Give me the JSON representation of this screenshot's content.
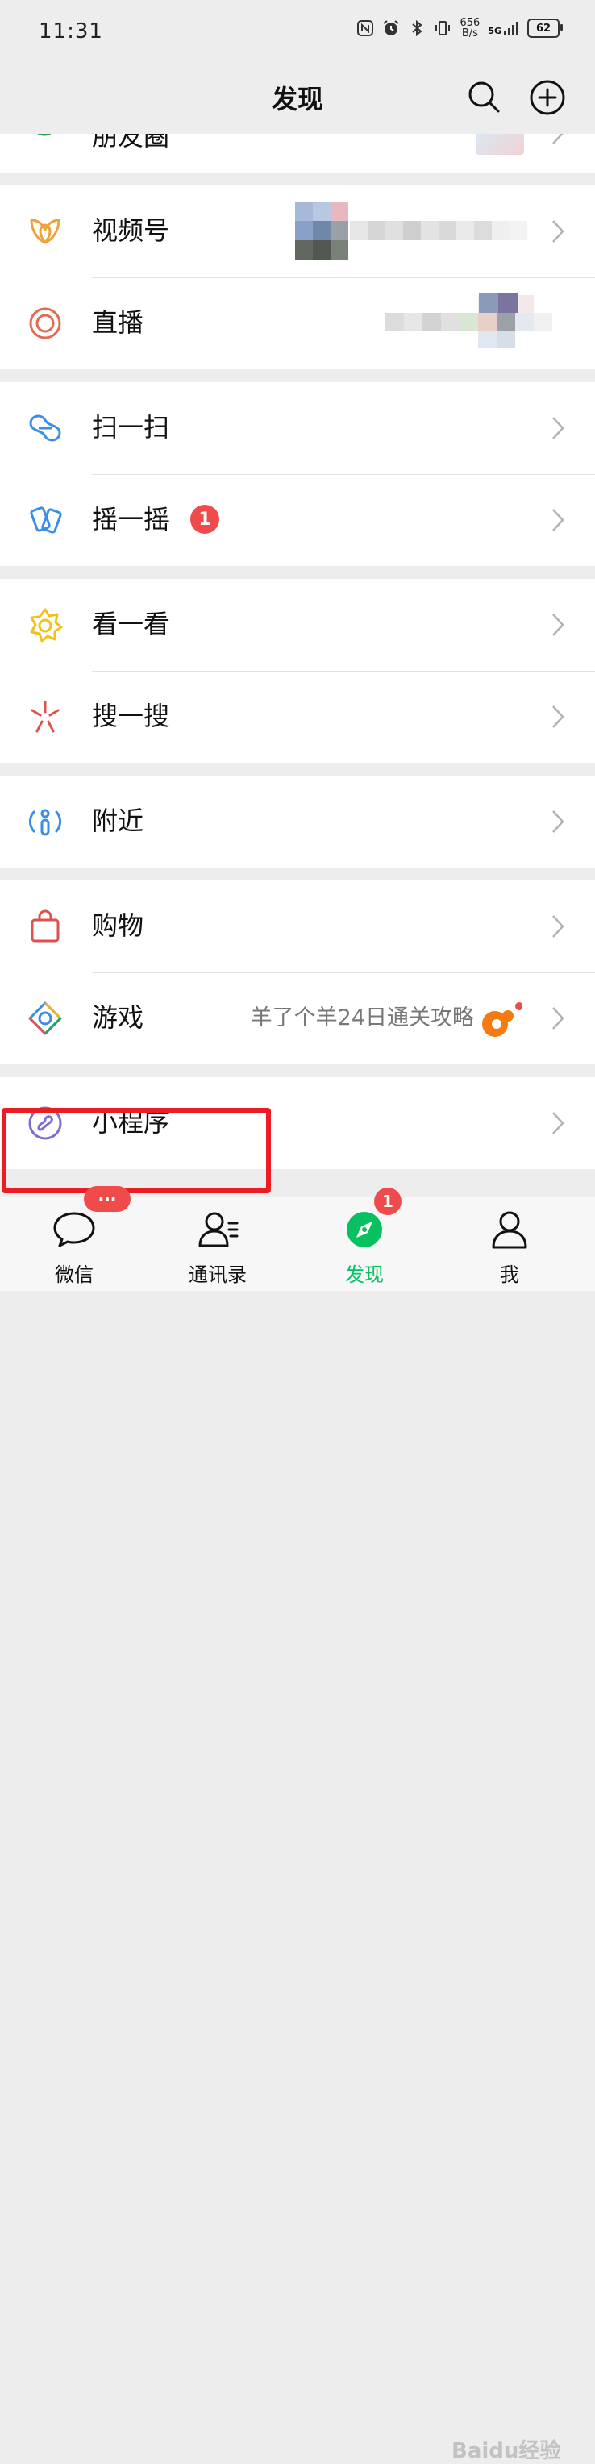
{
  "status": {
    "time": "11:31",
    "net_speed_value": "656",
    "net_speed_unit": "B/s",
    "signal": "5G",
    "battery": "62"
  },
  "nav": {
    "title": "发现"
  },
  "items": {
    "moments": "朋友圈",
    "channels": "视频号",
    "live": "直播",
    "scan": "扫一扫",
    "shake": "摇一摇",
    "shake_badge": "1",
    "top_stories": "看一看",
    "search": "搜一搜",
    "nearby": "附近",
    "shopping": "购物",
    "games": "游戏",
    "games_subtext": "羊了个羊24日通关攻略",
    "mini_programs": "小程序"
  },
  "tabbar": {
    "chats": "微信",
    "chats_badge": "···",
    "contacts": "通讯录",
    "discover": "发现",
    "discover_badge": "1",
    "me": "我"
  },
  "colors": {
    "accent_green": "#07c160",
    "badge_red": "#f04b4b",
    "highlight_red": "#ec1c24"
  },
  "watermark": "Baidu经验"
}
